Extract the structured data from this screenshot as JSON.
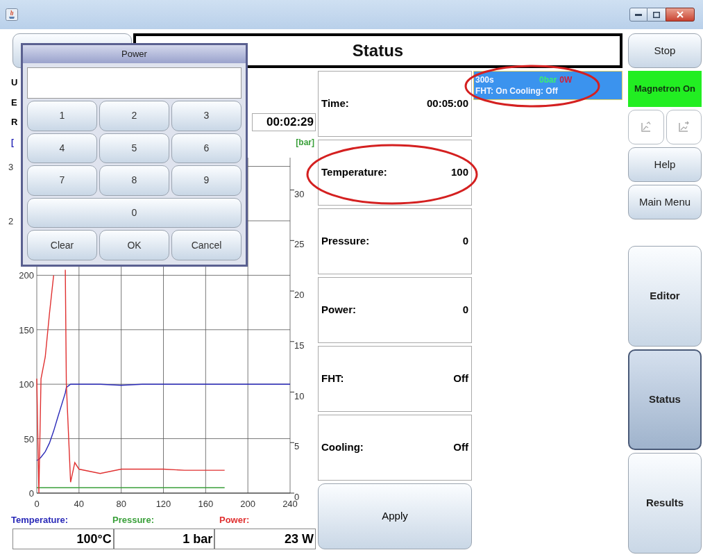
{
  "header": {
    "title": "Status"
  },
  "info": {
    "labels": [
      "U",
      "E",
      "R"
    ],
    "elapsed": "00:02:29",
    "left_unit": "[",
    "right_unit": "[bar]"
  },
  "chart": {
    "cut_labels": [
      "3",
      "2"
    ],
    "chart_data": {
      "type": "line",
      "grid": true,
      "xlim": [
        0,
        240
      ],
      "ylim": [
        0,
        308
      ],
      "y2lim": [
        0,
        33.2
      ],
      "x": [
        0,
        2,
        4,
        8,
        12,
        16,
        20,
        27,
        28,
        32,
        36,
        40,
        60,
        80,
        100,
        120,
        140,
        160,
        178,
        200,
        220,
        240
      ],
      "xticks": [
        0,
        40,
        80,
        120,
        160,
        200,
        240
      ],
      "yticks": [
        0,
        50,
        100,
        150,
        200
      ],
      "y2ticks": [
        0,
        5,
        10,
        15,
        20,
        25,
        30
      ],
      "series": [
        {
          "name": "Temperature:",
          "color": "#2a2ab8",
          "values": [
            30,
            31,
            33,
            38,
            46,
            57,
            70,
            92,
            97,
            100,
            100,
            100,
            100,
            99,
            100,
            100,
            100,
            100,
            100,
            100,
            100,
            100
          ]
        },
        {
          "name": "Pressure:",
          "color": "#3aa03a",
          "values": [
            5,
            5,
            5,
            5,
            5,
            5,
            5,
            5,
            5,
            5,
            5,
            5,
            5,
            5,
            5,
            5,
            5,
            5,
            5,
            null,
            null,
            null
          ]
        },
        {
          "name": "Power:",
          "color": "#e03030",
          "values": [
            105,
            0,
            105,
            125,
            165,
            200,
            null,
            205,
            100,
            10,
            28,
            22,
            18,
            22,
            22,
            22,
            21,
            21,
            21,
            null,
            null,
            null
          ]
        }
      ]
    }
  },
  "readings": [
    "100°C",
    "1 bar",
    "23 W"
  ],
  "status_cells": [
    {
      "label": "Time:",
      "value": "00:05:00"
    },
    {
      "label": "Temperature:",
      "value": "100"
    },
    {
      "label": "Pressure:",
      "value": "0"
    },
    {
      "label": "Power:",
      "value": "0"
    },
    {
      "label": "FHT:",
      "value": "Off"
    },
    {
      "label": "Cooling:",
      "value": "Off"
    }
  ],
  "apply_button": "Apply",
  "summary": {
    "time": "300s",
    "pressure": "0bar",
    "power": "0W",
    "line_2": "FHT: On Cooling: Off"
  },
  "side_buttons": [
    {
      "kind": "button",
      "label": "Stop"
    },
    {
      "kind": "indicator",
      "label": "Magnetron On",
      "on": true
    },
    {
      "kind": "icons"
    },
    {
      "kind": "button",
      "label": "Help"
    },
    {
      "kind": "button",
      "label": "Main Menu"
    }
  ],
  "nav": [
    {
      "label": "Editor",
      "selected": false
    },
    {
      "label": "Status",
      "selected": true
    },
    {
      "label": "Results",
      "selected": false
    }
  ],
  "dialog": {
    "title": "Power",
    "keys": [
      {
        "kind": "key",
        "label": "1"
      },
      {
        "kind": "key",
        "label": "2"
      },
      {
        "kind": "key",
        "label": "3"
      },
      {
        "kind": "key",
        "label": "4"
      },
      {
        "kind": "key",
        "label": "5"
      },
      {
        "kind": "key",
        "label": "6"
      },
      {
        "kind": "key",
        "label": "7"
      },
      {
        "kind": "key",
        "label": "8"
      },
      {
        "kind": "key",
        "label": "9"
      },
      {
        "kind": "wide",
        "label": "0"
      },
      {
        "kind": "key",
        "label": "Clear"
      },
      {
        "kind": "key",
        "label": "OK"
      },
      {
        "kind": "key",
        "label": "Cancel"
      }
    ]
  }
}
